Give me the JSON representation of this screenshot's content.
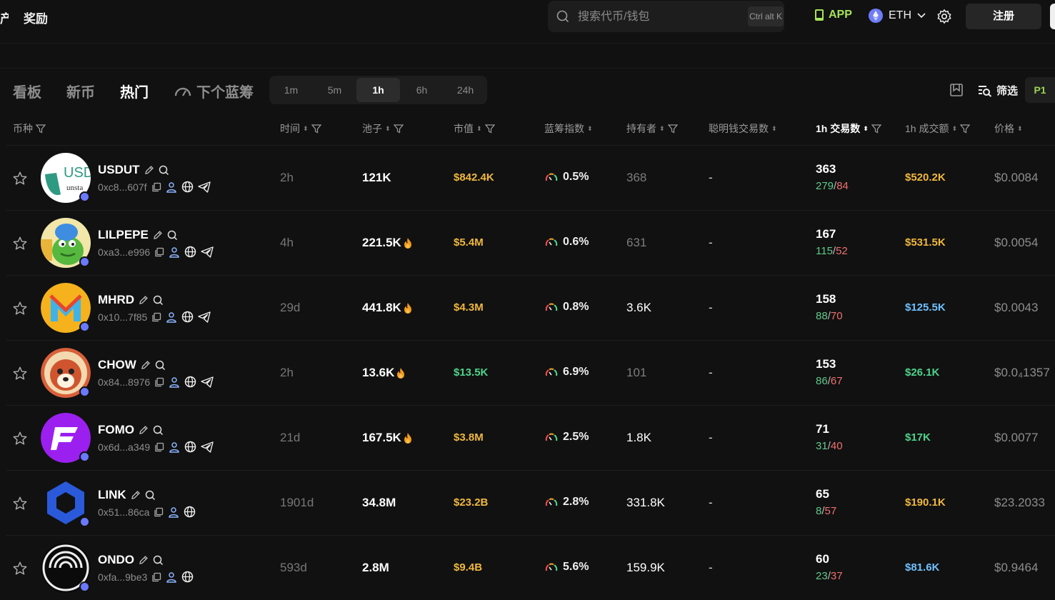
{
  "topbar": {
    "cut_label": "产",
    "reward_label": "奖励",
    "search_placeholder": "搜索代币/钱包",
    "search_shortcut": "Ctrl alt K",
    "app_label": "APP",
    "chain_label": "ETH",
    "signup_label": "注册"
  },
  "tabs": [
    {
      "label": "看板",
      "active": false
    },
    {
      "label": "新币",
      "active": false
    },
    {
      "label": "热门",
      "active": true
    },
    {
      "label": "下个蓝筹",
      "active": false
    }
  ],
  "timeframes": [
    {
      "label": "1m",
      "active": false
    },
    {
      "label": "5m",
      "active": false
    },
    {
      "label": "1h",
      "active": true
    },
    {
      "label": "6h",
      "active": false
    },
    {
      "label": "24h",
      "active": false
    }
  ],
  "toolbar": {
    "filter_label": "筛选",
    "page_label": "P1"
  },
  "columns": {
    "coin": "币种",
    "time": "时间",
    "pool": "池子",
    "mcap": "市值",
    "bluechip": "蓝筹指数",
    "holders": "持有者",
    "smart": "聪明钱交易数",
    "tx": "1h 交易数",
    "volume": "1h 成交额",
    "price": "价格"
  },
  "rows": [
    {
      "symbol": "USDUT",
      "address": "0xc8...607f",
      "time": "2h",
      "pool": "121K",
      "hot": false,
      "mcap": "$842.4K",
      "bluechip": "0.5%",
      "holders": "368",
      "smart": "-",
      "tx": "363",
      "buys": "279",
      "sells": "84",
      "volume": "$520.2K",
      "price": "$0.0084"
    },
    {
      "symbol": "LILPEPE",
      "address": "0xa3...e996",
      "time": "4h",
      "pool": "221.5K",
      "hot": true,
      "mcap": "$5.4M",
      "bluechip": "0.6%",
      "holders": "631",
      "smart": "-",
      "tx": "167",
      "buys": "115",
      "sells": "52",
      "volume": "$531.5K",
      "price": "$0.0054"
    },
    {
      "symbol": "MHRD",
      "address": "0x10...7f85",
      "time": "29d",
      "pool": "441.8K",
      "hot": true,
      "mcap": "$4.3M",
      "bluechip": "0.8%",
      "holders": "3.6K",
      "smart": "-",
      "tx": "158",
      "buys": "88",
      "sells": "70",
      "volume": "$125.5K",
      "price": "$0.0043"
    },
    {
      "symbol": "CHOW",
      "address": "0x84...8976",
      "time": "2h",
      "pool": "13.6K",
      "hot": true,
      "mcap": "$13.5K",
      "bluechip": "6.9%",
      "holders": "101",
      "smart": "-",
      "tx": "153",
      "buys": "86",
      "sells": "67",
      "volume": "$26.1K",
      "price": "$0.0₄1357"
    },
    {
      "symbol": "FOMO",
      "address": "0x6d...a349",
      "time": "21d",
      "pool": "167.5K",
      "hot": true,
      "mcap": "$3.8M",
      "bluechip": "2.5%",
      "holders": "1.8K",
      "smart": "-",
      "tx": "71",
      "buys": "31",
      "sells": "40",
      "volume": "$17K",
      "price": "$0.0077"
    },
    {
      "symbol": "LINK",
      "address": "0x51...86ca",
      "time": "1901d",
      "pool": "34.8M",
      "hot": false,
      "mcap": "$23.2B",
      "bluechip": "2.8%",
      "holders": "331.8K",
      "smart": "-",
      "tx": "65",
      "buys": "8",
      "sells": "57",
      "volume": "$190.1K",
      "price": "$23.2033"
    },
    {
      "symbol": "ONDO",
      "address": "0xfa...9be3",
      "time": "593d",
      "pool": "2.8M",
      "hot": false,
      "mcap": "$9.4B",
      "bluechip": "5.6%",
      "holders": "159.9K",
      "smart": "-",
      "tx": "60",
      "buys": "23",
      "sells": "37",
      "volume": "$81.6K",
      "price": "$0.9464"
    }
  ]
}
